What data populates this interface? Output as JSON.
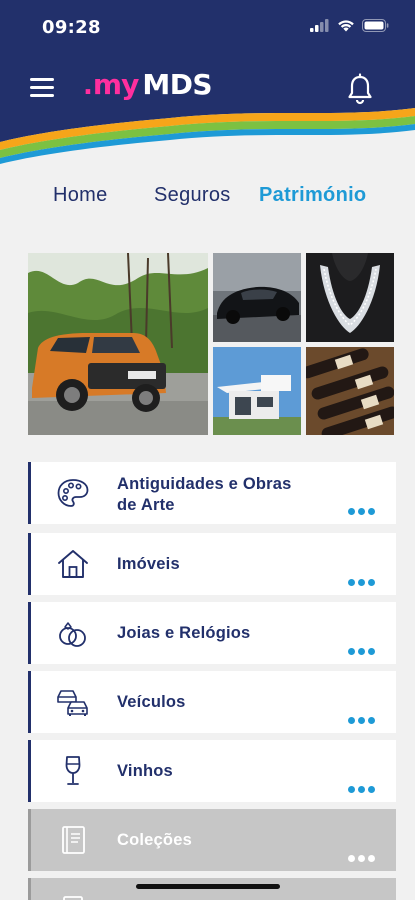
{
  "status_bar": {
    "time": "09:28",
    "icons": [
      "signal-icon",
      "wifi-icon",
      "battery-icon"
    ]
  },
  "header": {
    "menu_icon": "hamburger-menu-icon",
    "logo": {
      "prefix": ".",
      "my": "my",
      "brand": "MDS"
    },
    "bell_icon": "bell-icon",
    "colors": {
      "navy": "#22306b",
      "pink": "#ff2f9e",
      "wave_orange": "#f6a51a",
      "wave_green": "#7cc142",
      "wave_blue": "#1e9ad6"
    }
  },
  "tabs": [
    {
      "label": "Home",
      "active": false
    },
    {
      "label": "Seguros",
      "active": false
    },
    {
      "label": "Património",
      "active": true
    }
  ],
  "photos": [
    "orange-suv-photo",
    "black-sports-car-photo",
    "diamond-necklace-photo",
    "modern-house-photo",
    "wine-bottles-photo"
  ],
  "categories": [
    {
      "label": "Antiguidades e Obras\nde Arte",
      "icon": "palette-icon",
      "disabled": false
    },
    {
      "label": "Imóveis",
      "icon": "house-icon",
      "disabled": false
    },
    {
      "label": "Joias e Relógios",
      "icon": "rings-icon",
      "disabled": false
    },
    {
      "label": "Veículos",
      "icon": "cars-icon",
      "disabled": false
    },
    {
      "label": "Vinhos",
      "icon": "wine-glass-icon",
      "disabled": false
    },
    {
      "label": "Coleções",
      "icon": "book-icon",
      "disabled": true
    }
  ],
  "accent_colors": {
    "active_tab": "#1e9ad6",
    "item_text": "#22306b",
    "more_dots": "#1e9ad6",
    "disabled_bg": "#c6c6c6"
  }
}
